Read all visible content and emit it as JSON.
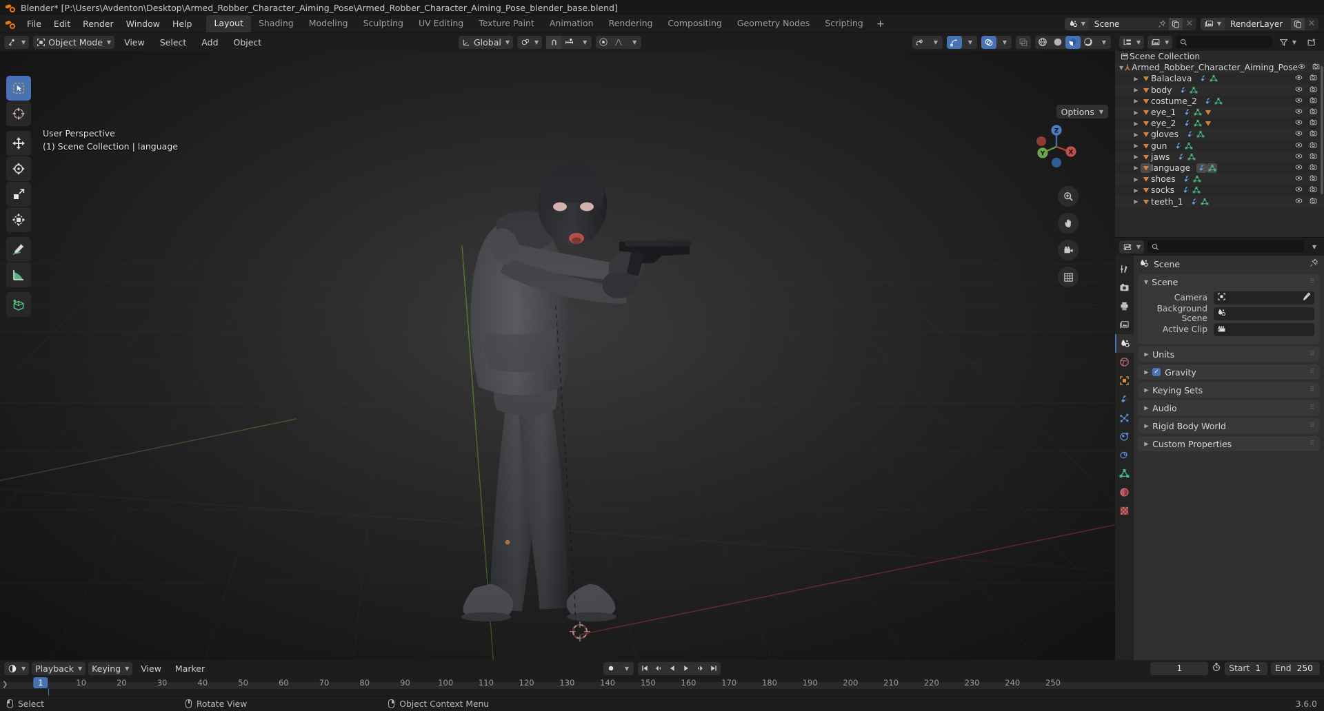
{
  "window": {
    "title": "Blender* [P:\\Users\\Avdenton\\Desktop\\Armed_Robber_Character_Aiming_Pose\\Armed_Robber_Character_Aiming_Pose_blender_base.blend]"
  },
  "topbar": {
    "menus": [
      "File",
      "Edit",
      "Render",
      "Window",
      "Help"
    ],
    "workspaces": [
      "Layout",
      "Shading",
      "Modeling",
      "Sculpting",
      "UV Editing",
      "Texture Paint",
      "Animation",
      "Rendering",
      "Compositing",
      "Geometry Nodes",
      "Scripting"
    ],
    "active_workspace": "Layout",
    "add_workspace": "+",
    "scene_name": "Scene",
    "view_layer_name": "RenderLayer"
  },
  "viewport": {
    "mode": "Object Mode",
    "menus": [
      "View",
      "Select",
      "Add",
      "Object"
    ],
    "transform_orientation": "Global",
    "options_label": "Options",
    "overlay_line1": "User Perspective",
    "overlay_line2": "(1) Scene Collection | language",
    "gizmo_axes": [
      "X",
      "Y",
      "Z"
    ]
  },
  "outliner": {
    "root": "Scene Collection",
    "collection": "Armed_Robber_Character_Aiming_Pose",
    "objects": [
      {
        "name": "Balaclava",
        "selected": false,
        "extra_mesh": false
      },
      {
        "name": "body",
        "selected": false,
        "extra_mesh": false
      },
      {
        "name": "costume_2",
        "selected": false,
        "extra_mesh": false
      },
      {
        "name": "eye_1",
        "selected": false,
        "extra_mesh": true
      },
      {
        "name": "eye_2",
        "selected": false,
        "extra_mesh": true
      },
      {
        "name": "gloves",
        "selected": false,
        "extra_mesh": false
      },
      {
        "name": "gun",
        "selected": false,
        "extra_mesh": false
      },
      {
        "name": "jaws",
        "selected": false,
        "extra_mesh": false
      },
      {
        "name": "language",
        "selected": true,
        "extra_mesh": false
      },
      {
        "name": "shoes",
        "selected": false,
        "extra_mesh": false
      },
      {
        "name": "socks",
        "selected": false,
        "extra_mesh": false
      },
      {
        "name": "teeth_1",
        "selected": false,
        "extra_mesh": false
      }
    ]
  },
  "properties": {
    "breadcrumb": "Scene",
    "scene_panel": {
      "title": "Scene",
      "rows": [
        {
          "label": "Camera",
          "value": ""
        },
        {
          "label": "Background Scene",
          "value": ""
        },
        {
          "label": "Active Clip",
          "value": ""
        }
      ]
    },
    "closed_panels": [
      {
        "label": "Units",
        "checkbox": false
      },
      {
        "label": "Gravity",
        "checkbox": true
      },
      {
        "label": "Keying Sets",
        "checkbox": false
      },
      {
        "label": "Audio",
        "checkbox": false
      },
      {
        "label": "Rigid Body World",
        "checkbox": false
      },
      {
        "label": "Custom Properties",
        "checkbox": false
      }
    ]
  },
  "timeline": {
    "menus": [
      "Playback",
      "Keying",
      "View",
      "Marker"
    ],
    "current_frame": "1",
    "start_label": "Start",
    "start_value": "1",
    "end_label": "End",
    "end_value": "250",
    "ticks": [
      "1",
      "10",
      "20",
      "30",
      "40",
      "50",
      "60",
      "70",
      "80",
      "90",
      "100",
      "110",
      "120",
      "130",
      "140",
      "150",
      "160",
      "170",
      "180",
      "190",
      "200",
      "210",
      "220",
      "230",
      "240",
      "250"
    ],
    "playhead_frame": "1"
  },
  "status": {
    "items": [
      "Select",
      "Rotate View",
      "Object Context Menu"
    ],
    "version": "3.6.0"
  },
  "colors": {
    "accent": "#4772b3",
    "orange": "#e87d0d",
    "mesh_green": "#5bc98a",
    "modifier_blue": "#6d9eeb"
  }
}
